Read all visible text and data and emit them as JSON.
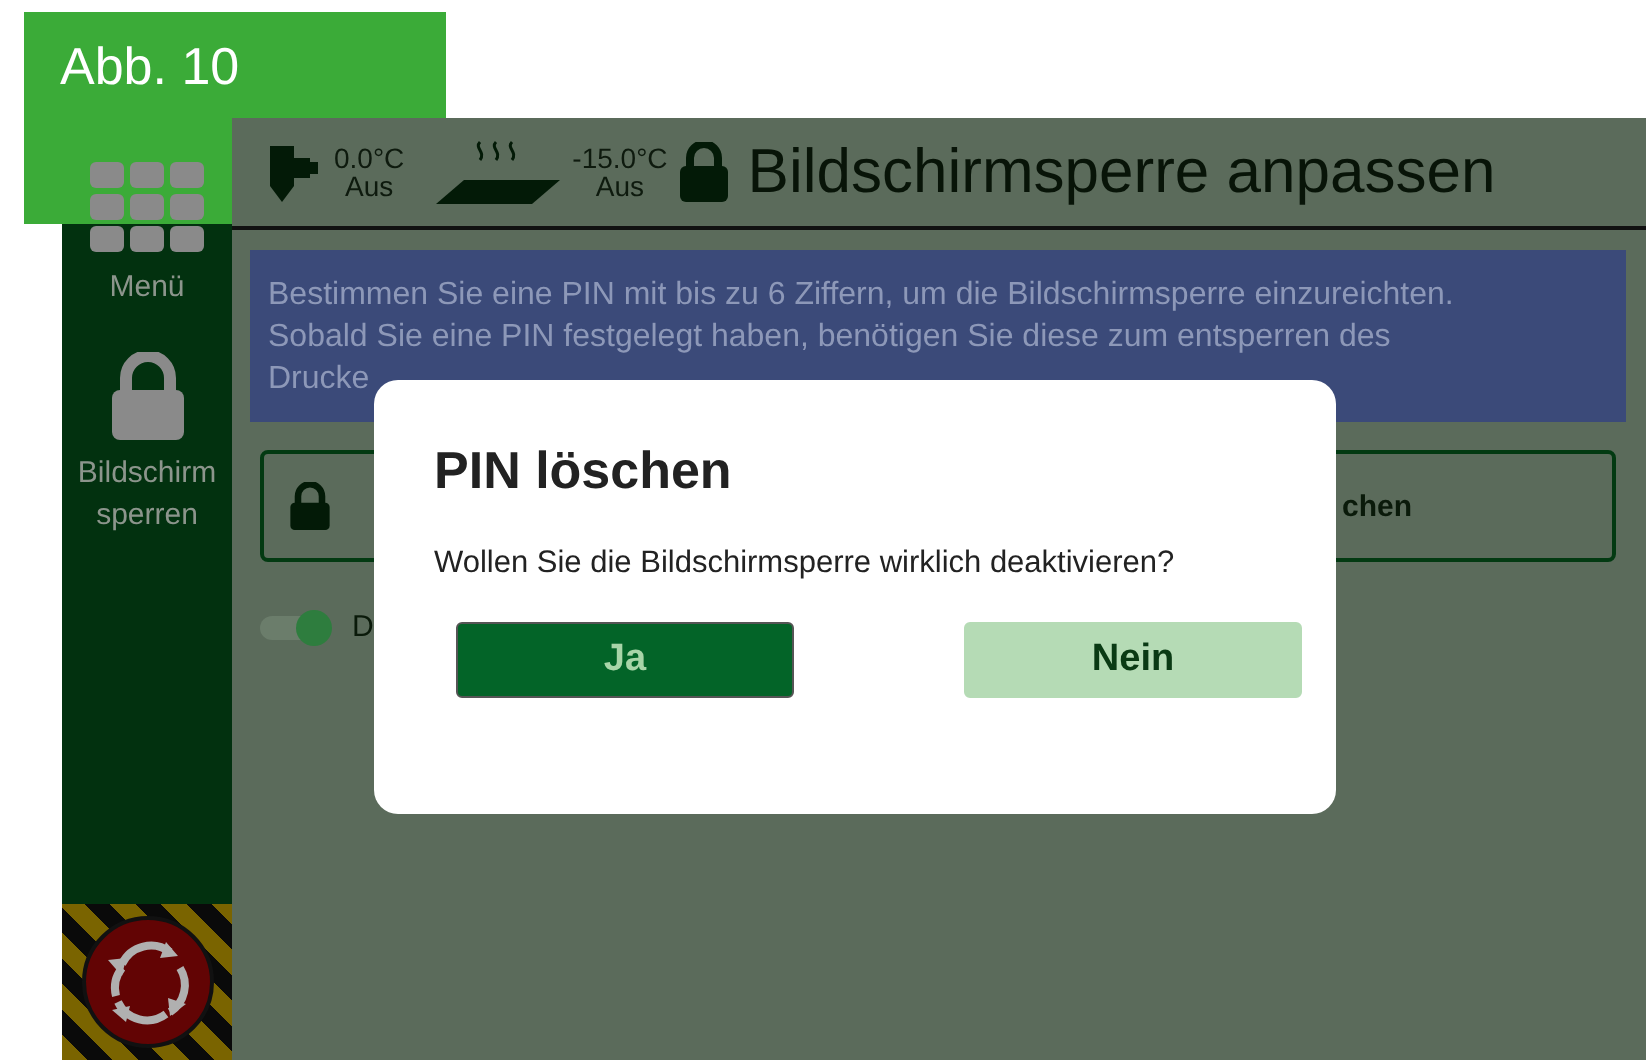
{
  "figure_label": "Abb. 10",
  "sidebar": {
    "items": [
      {
        "kind": "menu",
        "label": "Menü"
      },
      {
        "kind": "lock",
        "label": "Bildschirm sperren"
      }
    ]
  },
  "header": {
    "nozzle": {
      "temperature": "0.0°C",
      "state": "Aus"
    },
    "bed": {
      "temperature": "-15.0°C",
      "state": "Aus"
    },
    "title": "Bildschirmsperre anpassen"
  },
  "info": {
    "lines": [
      "Bestimmen Sie eine PIN mit bis zu 6 Ziffern, um die Bildschirmsperre einzureichten.",
      "Sobald Sie eine PIN festgelegt haben, benötigen Sie diese zum entsperren des",
      "Drucke"
    ]
  },
  "lock_button": {
    "label": "chen"
  },
  "toggle": {
    "label": "D",
    "on": true
  },
  "dialog": {
    "title": "PIN löschen",
    "message": "Wollen Sie die Bildschirmsperre wirklich deaktivieren?",
    "buttons": [
      {
        "label": "Ja",
        "kind": "primary"
      },
      {
        "label": "Nein",
        "kind": "secondary"
      }
    ]
  }
}
